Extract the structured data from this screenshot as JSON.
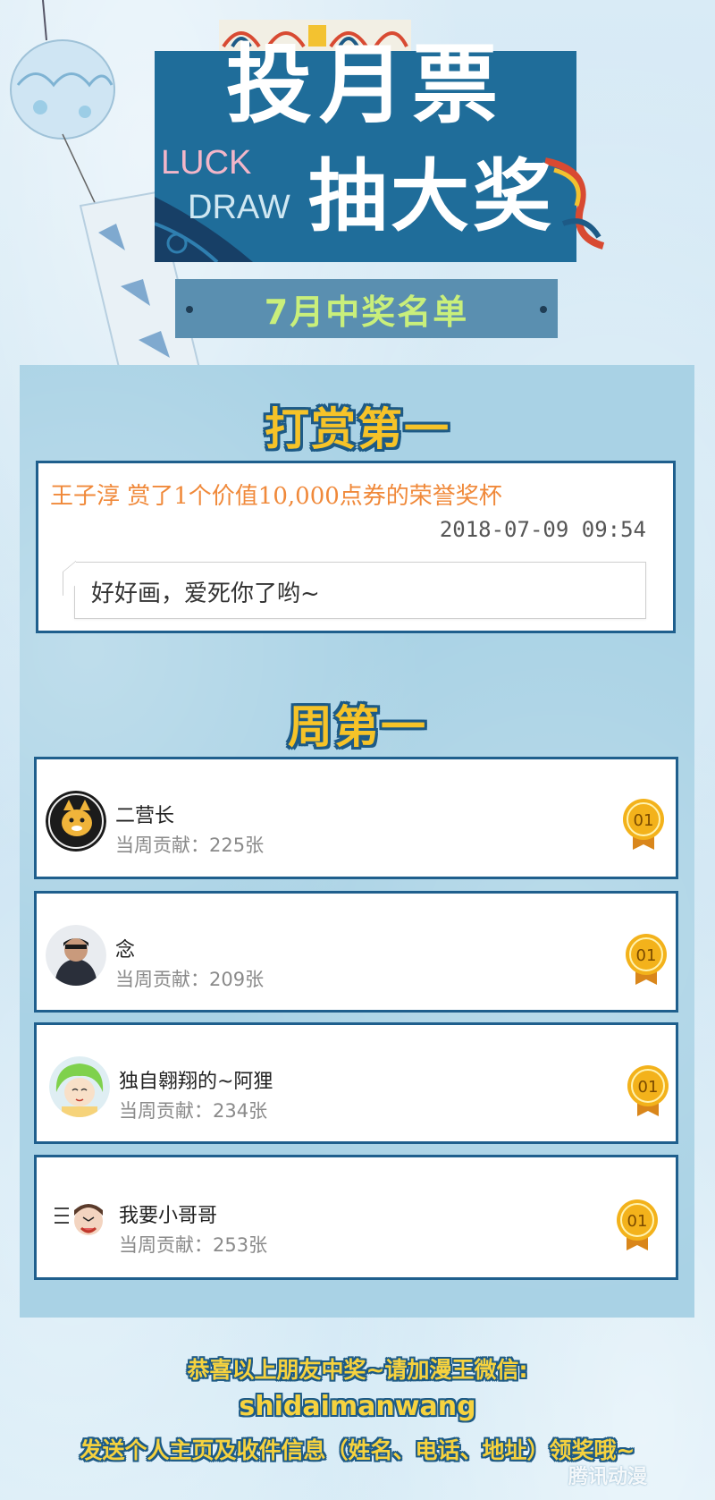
{
  "banner": {
    "title_line1": "投月票",
    "title_line2": "抽大奖",
    "luck": "LUCK",
    "draw": "DRAW",
    "subtitle": "7月中奖名单"
  },
  "reward_section": {
    "heading": "打赏第一",
    "line": "王子淳 赏了1个价值10,000点券的荣誉奖杯",
    "timestamp": "2018-07-09 09:54",
    "comment": "好好画，爱死你了哟~"
  },
  "weekly_section": {
    "heading": "周第一",
    "entries": [
      {
        "name": "二营长",
        "contribution": "当周贡献：225张",
        "medal": "01"
      },
      {
        "name": "念",
        "contribution": "当周贡献：209张",
        "medal": "01"
      },
      {
        "name": "独自翱翔的~阿狸",
        "contribution": "当周贡献：234张",
        "medal": "01"
      },
      {
        "name": "我要小哥哥",
        "contribution": "当周贡献：253张",
        "medal": "01"
      }
    ]
  },
  "footer": {
    "line1": "恭喜以上朋友中奖~请加漫王微信:",
    "line2": "shidaimanwang",
    "line3": "发送个人主页及收件信息（姓名、电话、地址）领奖哦~"
  },
  "watermark": "腾讯动漫",
  "colors": {
    "banner_blue": "#1f6d9a",
    "card_border": "#1f5f8d",
    "title_yellow": "#f6c328",
    "reward_orange": "#f0893a",
    "subtitle_green": "#c9ef7b",
    "medal_gold": "#f3b21b"
  }
}
